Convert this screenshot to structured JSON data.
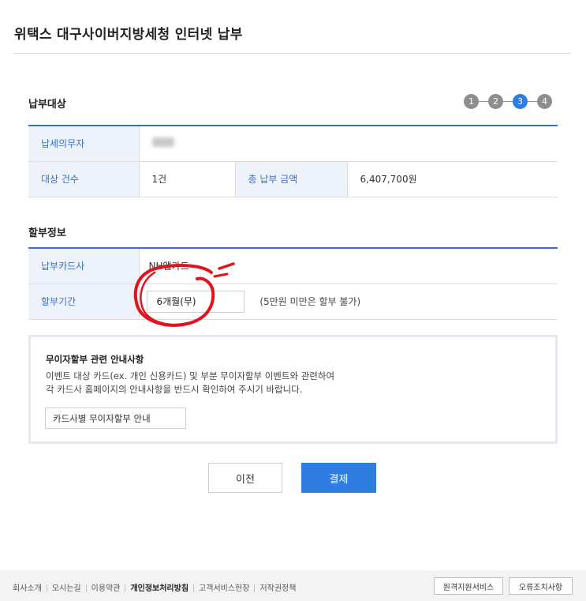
{
  "header": {
    "title": "위택스 대구사이버지방세청 인터넷 납부"
  },
  "payment_target": {
    "title": "납부대상",
    "steps": [
      "1",
      "2",
      "3",
      "4"
    ],
    "active_step": 3,
    "taxpayer_label": "납세의무자",
    "count_label": "대상 건수",
    "count_value": "1건",
    "total_label": "총 납부 금액",
    "total_value": "6,407,700원"
  },
  "installment": {
    "title": "할부정보",
    "card_company_label": "납부카드사",
    "card_company_value": "NH앱카드",
    "period_label": "할부기간",
    "period_value": "6개월(무)",
    "period_note": "(5만원 미만은 할부 불가)"
  },
  "notice": {
    "title": "무이자할부 관련 안내사항",
    "line1": "이벤트 대상 카드(ex. 개인 신용카드) 및 부분 무이자할부 이벤트와 관련하여",
    "line2": "각 카드사 홈페이지의 안내사항을 반드시 확인하여 주시기 바랍니다.",
    "guide_button": "카드사별 무이자할부 안내"
  },
  "actions": {
    "prev": "이전",
    "pay": "결제"
  },
  "footer": {
    "links": [
      "회사소개",
      "오시는길",
      "이용약관",
      "개인정보처리방침",
      "고객서비스헌장",
      "저작권정책"
    ],
    "remote_support": "원격지원서비스",
    "error_fix": "오류조치사항"
  },
  "colors": {
    "accent": "#2f7de1",
    "table_header_bg": "#eef3fb",
    "annotation": "#e0141e"
  }
}
